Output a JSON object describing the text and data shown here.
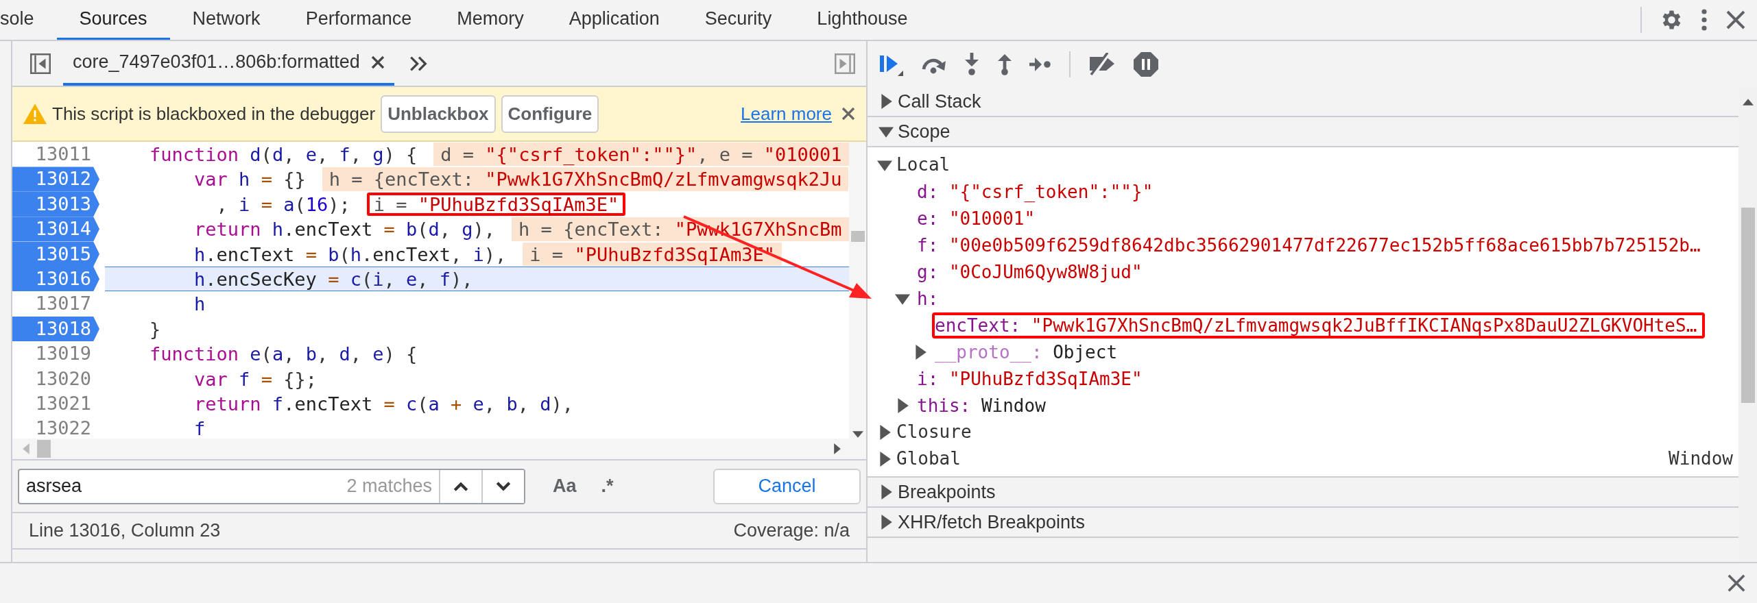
{
  "tabs": [
    {
      "label": "sole",
      "selected": false
    },
    {
      "label": "Sources",
      "selected": true
    },
    {
      "label": "Network",
      "selected": false
    },
    {
      "label": "Performance",
      "selected": false
    },
    {
      "label": "Memory",
      "selected": false
    },
    {
      "label": "Application",
      "selected": false
    },
    {
      "label": "Security",
      "selected": false
    },
    {
      "label": "Lighthouse",
      "selected": false
    }
  ],
  "editor_tab": {
    "label": "core_7497e03f01…806b:formatted"
  },
  "warning": {
    "message": "This script is blackboxed in the debugger",
    "buttons": [
      "Unblackbox",
      "Configure"
    ],
    "link": "Learn more"
  },
  "code_lines": [
    {
      "number": "13011",
      "breakpoint": false,
      "current": false,
      "code": "    function d(d, e, f, g) {",
      "inline": {
        "annotated": false,
        "segments": [
          {
            "text": "d = ",
            "kind": "plain"
          },
          {
            "text": "\"{\"csrf_token\":\"\"}\"",
            "kind": "string"
          },
          {
            "text": ", e = ",
            "kind": "plain"
          },
          {
            "text": "\"010001",
            "kind": "string"
          }
        ]
      }
    },
    {
      "number": "13012",
      "breakpoint": true,
      "current": false,
      "code": "        var h = {}",
      "inline": {
        "annotated": false,
        "segments": [
          {
            "text": "h = {encText: ",
            "kind": "plain"
          },
          {
            "text": "\"Pwwk1G7XhSncBmQ/zLfmvamgwsqk2Ju",
            "kind": "string"
          }
        ]
      }
    },
    {
      "number": "13013",
      "breakpoint": true,
      "current": false,
      "code": "          , i = a(16);",
      "inline": {
        "annotated": true,
        "segments": [
          {
            "text": "i = ",
            "kind": "plain"
          },
          {
            "text": "\"PUhuBzfd3SqIAm3E\"",
            "kind": "string"
          }
        ]
      }
    },
    {
      "number": "13014",
      "breakpoint": true,
      "current": false,
      "code": "        return h.encText = b(d, g),",
      "inline": {
        "annotated": false,
        "segments": [
          {
            "text": "h = {encText: ",
            "kind": "plain"
          },
          {
            "text": "\"Pwwk1G7XhSncBm",
            "kind": "string"
          }
        ]
      }
    },
    {
      "number": "13015",
      "breakpoint": true,
      "current": false,
      "code": "        h.encText = b(h.encText, i),",
      "inline": {
        "annotated": false,
        "segments": [
          {
            "text": "i = ",
            "kind": "plain"
          },
          {
            "text": "\"PUhuBzfd3SqIAm3E\"",
            "kind": "string"
          }
        ]
      }
    },
    {
      "number": "13016",
      "breakpoint": true,
      "current": true,
      "code": "        h.encSecKey = c(i, e, f),"
    },
    {
      "number": "13017",
      "breakpoint": false,
      "current": false,
      "code": "        h"
    },
    {
      "number": "13018",
      "breakpoint": true,
      "current": false,
      "code": "    }"
    },
    {
      "number": "13019",
      "breakpoint": false,
      "current": false,
      "code": "    function e(a, b, d, e) {"
    },
    {
      "number": "13020",
      "breakpoint": false,
      "current": false,
      "code": "        var f = {};"
    },
    {
      "number": "13021",
      "breakpoint": false,
      "current": false,
      "code": "        return f.encText = c(a + e, b, d),"
    },
    {
      "number": "13022",
      "breakpoint": false,
      "current": false,
      "code": "        f"
    }
  ],
  "search": {
    "value": "asrsea",
    "count": "2 matches",
    "case_button": "Aa",
    "regex_button": ".*",
    "cancel": "Cancel"
  },
  "status": {
    "position": "Line 13016, Column 23",
    "coverage": "Coverage: n/a"
  },
  "sections": [
    {
      "label": "Call Stack",
      "expanded": false
    },
    {
      "label": "Scope",
      "expanded": true,
      "children": [
        {
          "kind": "scope",
          "label": "Local",
          "expanded": true,
          "children": [
            {
              "kind": "string",
              "name": "d:",
              "value": "\"{\"csrf_token\":\"\"}\""
            },
            {
              "kind": "string",
              "name": "e:",
              "value": "\"010001\""
            },
            {
              "kind": "string",
              "name": "f:",
              "value": "\"00e0b509f6259df8642dbc35662901477df22677ec152b5ff68ace615bb7b725152b…"
            },
            {
              "kind": "string",
              "name": "g:",
              "value": "\"0CoJUm6Qyw8W8jud\""
            },
            {
              "kind": "object",
              "name": "h:",
              "expanded": true,
              "children": [
                {
                  "kind": "string",
                  "name": "encText:",
                  "value": "\"Pwwk1G7XhSncBmQ/zLfmvamgwsqk2JuBffIKCIANqsPx8DauU2ZLGKVOHteS…",
                  "annotated": true
                },
                {
                  "kind": "object",
                  "name": "__proto__:",
                  "value": "Object",
                  "expanded": false,
                  "internal": true,
                  "annotated": false
                }
              ]
            },
            {
              "kind": "string",
              "name": "i:",
              "value": "\"PUhuBzfd3SqIAm3E\""
            },
            {
              "kind": "object",
              "name": "this:",
              "value": "Window",
              "expanded": false
            }
          ]
        },
        {
          "kind": "scope",
          "label": "Closure",
          "expanded": false
        },
        {
          "kind": "scope",
          "label": "Global",
          "expanded": false,
          "value": "Window"
        }
      ]
    },
    {
      "label": "Breakpoints",
      "expanded": false
    },
    {
      "label": "XHR/fetch Breakpoints",
      "expanded": false
    }
  ],
  "annotation_arrow": true
}
